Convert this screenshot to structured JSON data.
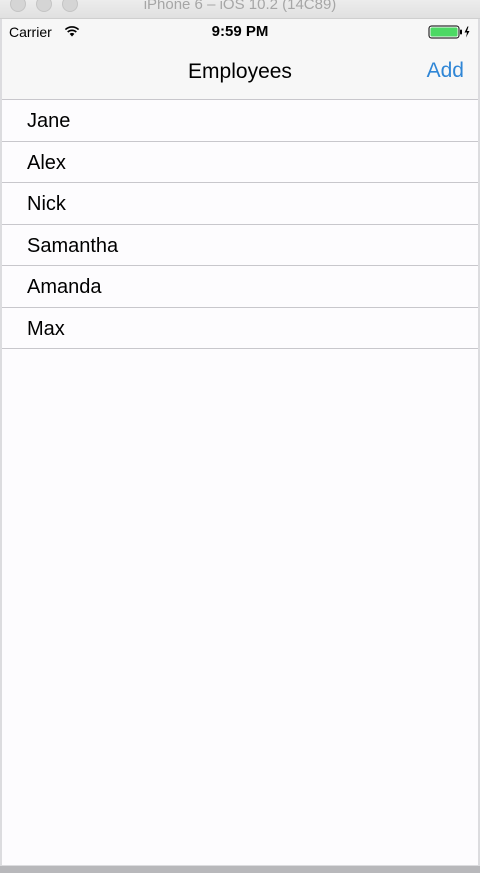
{
  "window": {
    "title": "iPhone 6 – iOS 10.2 (14C89)"
  },
  "status_bar": {
    "carrier": "Carrier",
    "time": "9:59 PM",
    "wifi_icon": "wifi-icon",
    "battery_icon": "battery-charging-icon",
    "battery_level": 1.0,
    "battery_color": "#4cd964"
  },
  "nav_bar": {
    "title": "Employees",
    "add_label": "Add",
    "tint_color": "#2f86d6"
  },
  "employees": [
    "Jane",
    "Alex",
    "Nick",
    "Samantha",
    "Amanda",
    "Max"
  ]
}
